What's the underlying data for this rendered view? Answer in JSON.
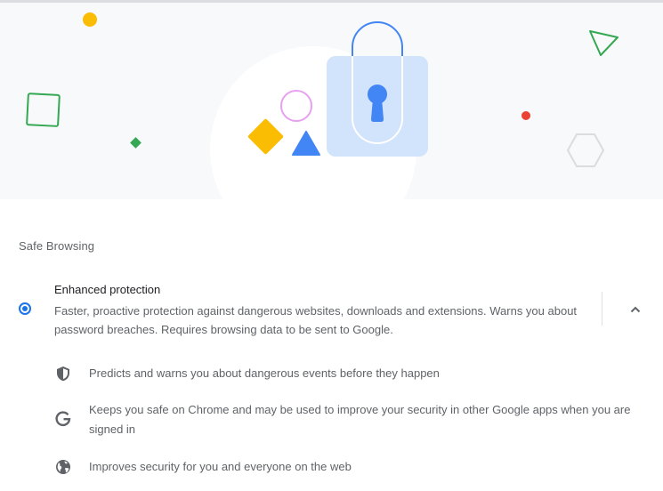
{
  "section": {
    "title": "Safe Browsing"
  },
  "option": {
    "label": "Enhanced protection",
    "description": "Faster, proactive protection against dangerous websites, downloads and extensions. Warns you about password breaches. Requires browsing data to be sent to Google.",
    "selected": true,
    "expanded": true
  },
  "features": [
    {
      "icon": "shield-icon",
      "text": "Predicts and warns you about dangerous events before they happen"
    },
    {
      "icon": "google-g-icon",
      "text": "Keeps you safe on Chrome and may be used to improve your security in other Google apps when you are signed in"
    },
    {
      "icon": "globe-icon",
      "text": "Improves security for you and everyone on the web"
    }
  ],
  "colors": {
    "accent": "#1a73e8",
    "banner_bg": "#f8f9fa",
    "yellow": "#fbbc04",
    "green": "#34a853",
    "red": "#ea4335",
    "blue": "#4285f4",
    "lock_body": "#d2e3fc",
    "pink": "#e8a0f0",
    "grey": "#dadce0"
  }
}
